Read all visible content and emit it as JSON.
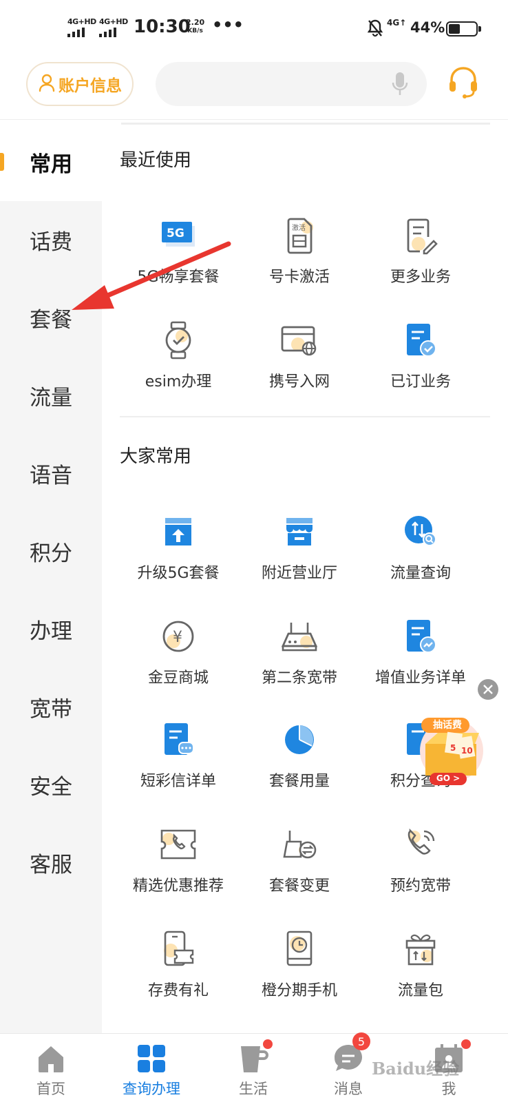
{
  "status_bar": {
    "net1_label": "4G+HD",
    "net2_label": "4G+HD",
    "time": "10:30",
    "speed_value": "2.20",
    "speed_unit": "KB/s",
    "more": "•••",
    "net3_label": "4G↑",
    "battery_pct_text": "44%",
    "battery_level": 0.44
  },
  "header": {
    "account_label": "账户信息",
    "search_placeholder": "",
    "icons": [
      "user-icon",
      "mic-icon",
      "headset-icon"
    ]
  },
  "sidebar": {
    "items": [
      {
        "label": "常用",
        "active": true
      },
      {
        "label": "话费",
        "active": false
      },
      {
        "label": "套餐",
        "active": false
      },
      {
        "label": "流量",
        "active": false
      },
      {
        "label": "语音",
        "active": false
      },
      {
        "label": "积分",
        "active": false
      },
      {
        "label": "办理",
        "active": false
      },
      {
        "label": "宽带",
        "active": false
      },
      {
        "label": "安全",
        "active": false
      },
      {
        "label": "客服",
        "active": false
      }
    ]
  },
  "recent": {
    "title": "最近使用",
    "items": [
      {
        "label": "5G畅享套餐",
        "icon": "5g-icon"
      },
      {
        "label": "号卡激活",
        "icon": "sim-activate-icon",
        "icon_text": "激活"
      },
      {
        "label": "更多业务",
        "icon": "document-edit-icon"
      },
      {
        "label": "esim办理",
        "icon": "watch-icon"
      },
      {
        "label": "携号入网",
        "icon": "card-globe-icon"
      },
      {
        "label": "已订业务",
        "icon": "document-check-icon"
      }
    ]
  },
  "common": {
    "title": "大家常用",
    "items": [
      {
        "label": "升级5G套餐",
        "icon": "upgrade-box-icon"
      },
      {
        "label": "附近营业厅",
        "icon": "store-icon"
      },
      {
        "label": "流量查询",
        "icon": "data-search-icon"
      },
      {
        "label": "金豆商城",
        "icon": "yen-coin-icon",
        "icon_text": "¥"
      },
      {
        "label": "第二条宽带",
        "icon": "router-icon"
      },
      {
        "label": "增值业务详单",
        "icon": "document-chart-icon"
      },
      {
        "label": "短彩信详单",
        "icon": "document-message-icon"
      },
      {
        "label": "套餐用量",
        "icon": "pie-chart-icon"
      },
      {
        "label": "积分查询",
        "icon": "document-points-icon"
      },
      {
        "label": "精选优惠推荐",
        "icon": "phone-card-icon"
      },
      {
        "label": "套餐变更",
        "icon": "router-exchange-icon"
      },
      {
        "label": "预约宽带",
        "icon": "phone-call-icon"
      },
      {
        "label": "存费有礼",
        "icon": "phone-ticket-icon"
      },
      {
        "label": "橙分期手机",
        "icon": "phone-clock-icon"
      },
      {
        "label": "流量包",
        "icon": "gift-box-icon"
      }
    ]
  },
  "promo": {
    "label": "抽话费",
    "cta": "GO >",
    "numbers": [
      "5",
      "10"
    ]
  },
  "tabbar": {
    "items": [
      {
        "label": "首页",
        "icon": "home-icon",
        "active": false
      },
      {
        "label": "查询办理",
        "icon": "grid-icon",
        "active": true
      },
      {
        "label": "生活",
        "icon": "cup-icon",
        "active": false,
        "dot": true
      },
      {
        "label": "消息",
        "icon": "message-icon",
        "active": false,
        "badge": "5"
      },
      {
        "label": "我",
        "icon": "calendar-person-icon",
        "active": false,
        "dot": true
      }
    ]
  },
  "watermark": "Baidu经验",
  "colors": {
    "accent": "#f5a623",
    "blue": "#1a7fe0",
    "badge": "#f2473f",
    "annotation": "#e8362f"
  }
}
